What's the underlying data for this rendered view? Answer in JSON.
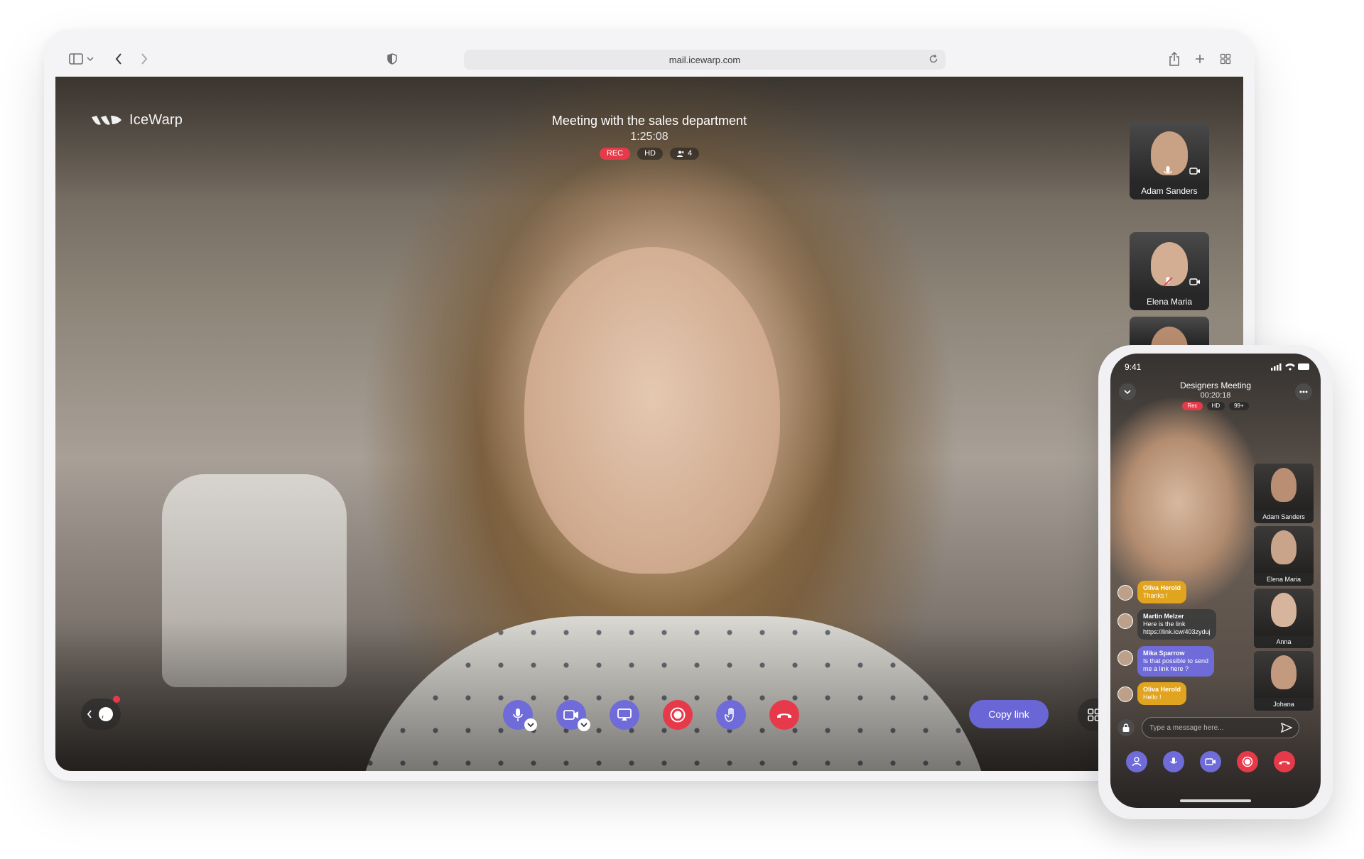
{
  "browser": {
    "url": "mail.icewarp.com"
  },
  "desktop": {
    "app_name": "IceWarp",
    "meeting_title": "Meeting with the sales department",
    "timer": "1:25:08",
    "badges": {
      "rec": "REC",
      "hd": "HD",
      "participants": "4"
    },
    "participants": [
      {
        "name": "Adam Sanders"
      },
      {
        "name": "Elena Maria"
      }
    ],
    "copy_link_label": "Copy link"
  },
  "mobile": {
    "status_time": "9:41",
    "meeting_title": "Designers Meeting",
    "timer": "00:20:18",
    "badges": {
      "rec": "Rec",
      "hd": "HD",
      "participants": "99+"
    },
    "participants": [
      {
        "name": "Adam Sanders"
      },
      {
        "name": "Elena Maria"
      },
      {
        "name": "Anna"
      },
      {
        "name": "Johana"
      }
    ],
    "messages": [
      {
        "author": "Oliva Herold",
        "text": "Thanks !",
        "style": "yellow"
      },
      {
        "author": "Martin Melzer",
        "text": "Here is the link",
        "text2": "https://link.icw/403zyduj",
        "style": "gray"
      },
      {
        "author": "Mika Sparrow",
        "text": "Is that possible to send",
        "text2": "me a link here ?",
        "style": "purple"
      },
      {
        "author": "Oliva Herold",
        "text": "Hello !",
        "style": "yellow"
      }
    ],
    "input_placeholder": "Type a message here..."
  },
  "colors": {
    "accent": "#6f6bd8",
    "danger": "#e63a4a",
    "chat_yellow": "#e0a41e"
  }
}
